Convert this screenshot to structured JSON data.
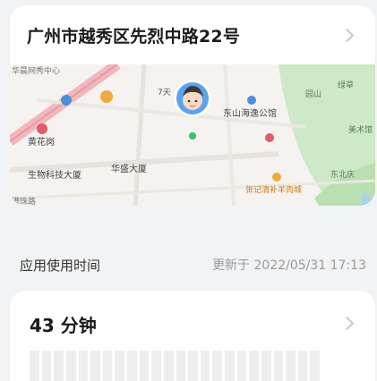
{
  "location": {
    "address": "广州市越秀区先烈中路22号",
    "chevron_icon": "chevron-right-icon",
    "map": {
      "labels": {
        "top_left": "华晨网秀中心",
        "tianhe": "7天",
        "dongshan_hotel": "东山海逸公馆",
        "huanghuagang": "黄花岗",
        "biotech_building": "生物科技大厦",
        "huasheng_building": "华盛大厦",
        "zhangji_restaurant": "张记清补羊肉城",
        "garden": "园山",
        "park_right": "美术馆",
        "park_east": "东北庆",
        "top_right": "绿草",
        "bottom_left": "港珠路"
      },
      "avatar_icon": "avatar-icon",
      "colors": {
        "park": "#cde9c8",
        "road": "#f2b7bc",
        "marker": "#3cc46a",
        "avatar_ring": "#ffffff",
        "avatar_bg": "#5aa4ef"
      }
    }
  },
  "usage": {
    "section_title": "应用使用时间",
    "updated": "更新于 2022/05/31 17:13",
    "total": "43 分钟",
    "bar_count": 24
  }
}
